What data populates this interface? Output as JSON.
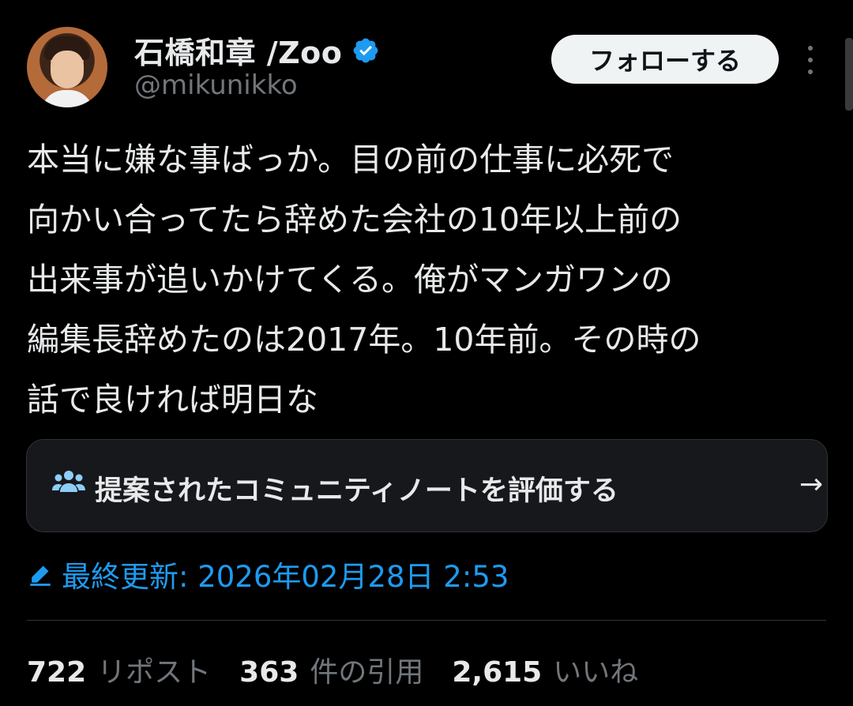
{
  "author": {
    "display_name": "石橋和章 /Zoo",
    "handle": "@mikunikko",
    "verified": true,
    "avatar": "boy-portrait-photo"
  },
  "actions": {
    "follow_label": "フォローする",
    "more_icon": "more-vertical-icon"
  },
  "tweet": {
    "text": "本当に嫌な事ばっか。目の前の仕事に必死で\n向かい合ってたら辞めた会社の10年以上前の\n出来事が追いかけてくる。俺がマンガワンの\n編集長辞めたのは2017年。10年前。その時の\n話で良ければ明日な"
  },
  "community_note": {
    "label": "提案されたコミュニティノートを評価する",
    "icon": "people-icon",
    "arrow": "→"
  },
  "edited": {
    "text": "最終更新: 2026年02月28日 2:53",
    "icon": "pencil-icon"
  },
  "stats": [
    {
      "count": "722",
      "label": "リポスト"
    },
    {
      "count": "363",
      "label": "件の引用"
    },
    {
      "count": "2,615",
      "label": "いいね"
    }
  ],
  "colors": {
    "background": "#000000",
    "text": "#e7e9ea",
    "muted": "#71767b",
    "accent": "#1d9bf0",
    "card_bg": "#16181c",
    "border": "#2f3336"
  }
}
